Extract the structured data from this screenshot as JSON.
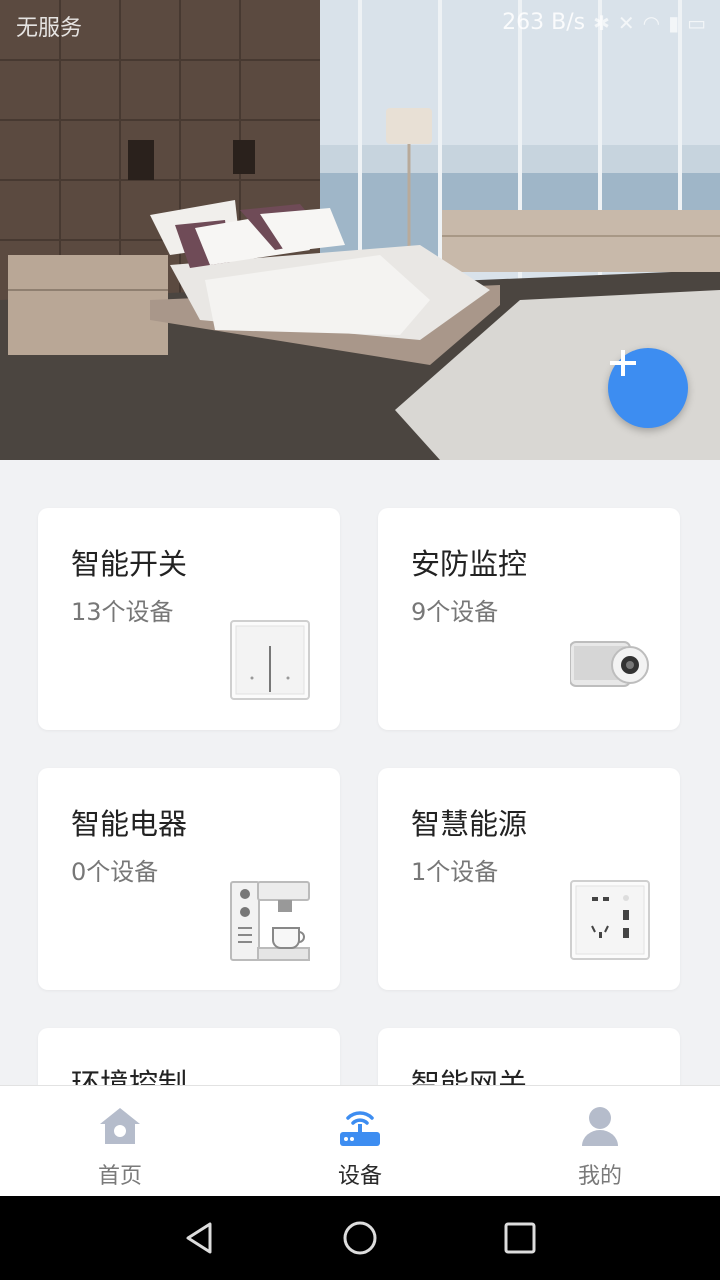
{
  "status_bar": {
    "carrier": "无服务",
    "speed": "263 B/s"
  },
  "hero": {
    "add_icon": "plus-icon",
    "accent": "#3d8df1"
  },
  "categories": [
    {
      "title": "智能开关",
      "count": "13个设备",
      "icon": "switch-icon"
    },
    {
      "title": "安防监控",
      "count": "9个设备",
      "icon": "camera-icon"
    },
    {
      "title": "智能电器",
      "count": "0个设备",
      "icon": "coffee-machine-icon"
    },
    {
      "title": "智慧能源",
      "count": "1个设备",
      "icon": "socket-icon"
    },
    {
      "title": "环境控制",
      "count": "",
      "icon": ""
    },
    {
      "title": "智能网关",
      "count": "",
      "icon": ""
    }
  ],
  "tabs": [
    {
      "label": "首页",
      "icon": "home-icon"
    },
    {
      "label": "设备",
      "icon": "router-icon",
      "active": true
    },
    {
      "label": "我的",
      "icon": "person-icon"
    }
  ],
  "colors": {
    "tab_active": "#3d8df1",
    "tab_inactive": "#b5bccb"
  }
}
